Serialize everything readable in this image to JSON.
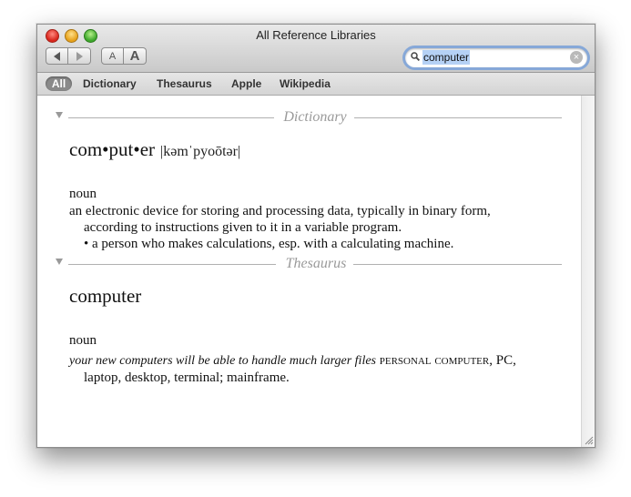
{
  "window": {
    "title": "All Reference Libraries"
  },
  "toolbar": {
    "back_icon": "back-arrow-icon",
    "forward_icon": "forward-arrow-icon",
    "font_small_label": "A",
    "font_large_label": "A"
  },
  "search": {
    "value": "computer"
  },
  "scopes": [
    "All",
    "Dictionary",
    "Thesaurus",
    "Apple",
    "Wikipedia"
  ],
  "dictionary": {
    "section_label": "Dictionary",
    "headword": "com•put•er",
    "pronunciation": "|kəmˈpyoōtər|",
    "part_of_speech": "noun",
    "definition_line1": "an electronic device for storing and processing data, typically in binary form,",
    "definition_line2": "according to instructions given to it in a variable program.",
    "definition_sub": "• a person who makes calculations, esp. with a calculating machine."
  },
  "thesaurus": {
    "section_label": "Thesaurus",
    "headword": "computer",
    "part_of_speech": "noun",
    "example": "your new computers will be able to handle much larger files",
    "synonym_primary": "personal computer",
    "synonyms_rest_line1": ", PC,",
    "synonyms_line2": "laptop, desktop, terminal; mainframe."
  },
  "colors": {
    "accent_focus": "#86a8d8",
    "selection": "#b5d1f5",
    "section_label": "#9a9a9a"
  }
}
